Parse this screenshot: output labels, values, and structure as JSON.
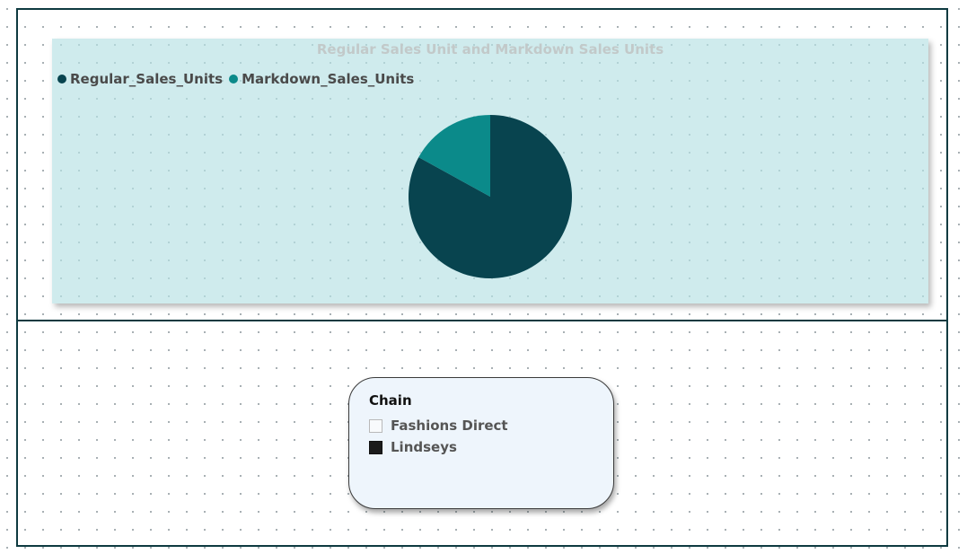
{
  "chart_data": {
    "type": "pie",
    "title": "Regular Sales Unit and Markdown Sales Units",
    "legend_position": "top-left",
    "categories": [
      "Regular_Sales_Units",
      "Markdown_Sales_Units"
    ],
    "values": [
      83,
      17
    ],
    "colors": [
      "#08444f",
      "#0b8a8a"
    ]
  },
  "slicer": {
    "title": "Chain",
    "options": [
      {
        "label": "Fashions Direct",
        "checked": false
      },
      {
        "label": "Lindseys",
        "checked": true
      }
    ]
  }
}
